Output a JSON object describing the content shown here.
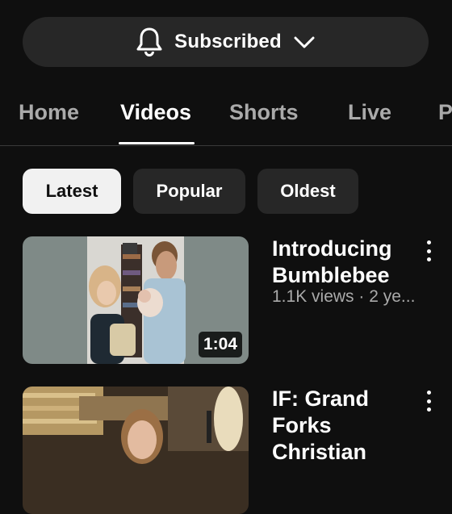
{
  "subscribe": {
    "label": "Subscribed",
    "bell_icon": "bell-icon",
    "chevron_icon": "chevron-down-icon"
  },
  "tabs": [
    {
      "label": "Home",
      "active": false
    },
    {
      "label": "Videos",
      "active": true
    },
    {
      "label": "Shorts",
      "active": false
    },
    {
      "label": "Live",
      "active": false
    },
    {
      "label": "P",
      "active": false
    }
  ],
  "filters": [
    {
      "label": "Latest",
      "active": true
    },
    {
      "label": "Popular",
      "active": false
    },
    {
      "label": "Oldest",
      "active": false
    }
  ],
  "videos": [
    {
      "title": "Introducing Bumblebee",
      "meta": "1.1K views · 2 ye...",
      "duration": "1:04"
    },
    {
      "title": "IF: Grand Forks Christian",
      "meta": "",
      "duration": ""
    }
  ],
  "colors": {
    "background": "#0f0f0f",
    "chip_bg": "#272727",
    "active_chip_bg": "#f1f1f1",
    "muted_text": "#aaaaaa"
  }
}
